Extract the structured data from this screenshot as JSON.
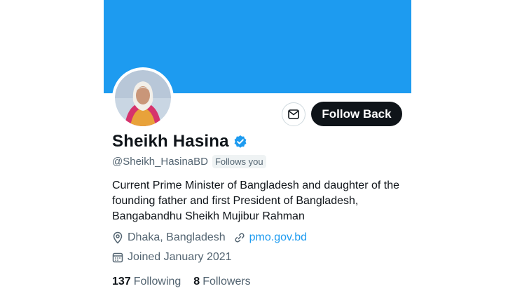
{
  "profile": {
    "name": "Sheikh Hasina",
    "handle": "@Sheikh_HasinaBD",
    "follows_you": "Follows you",
    "bio": "Current Prime Minister of Bangladesh and daughter of the founding father and first President of Bangladesh, Bangabandhu Sheikh Mujibur Rahman",
    "location": "Dhaka, Bangladesh",
    "website": "pmo.gov.bd",
    "joined": "Joined January 2021",
    "following_count": "137",
    "following_label": "Following",
    "followers_count": "8",
    "followers_label": "Followers"
  },
  "actions": {
    "follow_back": "Follow Back",
    "message_icon": "envelope-icon"
  },
  "icons": {
    "verified": "verified-badge-icon",
    "location": "location-pin-icon",
    "link": "link-icon",
    "calendar": "calendar-icon"
  },
  "colors": {
    "banner": "#1d9bf0",
    "accent": "#1d9bf0",
    "button_dark": "#0f1419",
    "secondary_text": "#536471"
  }
}
